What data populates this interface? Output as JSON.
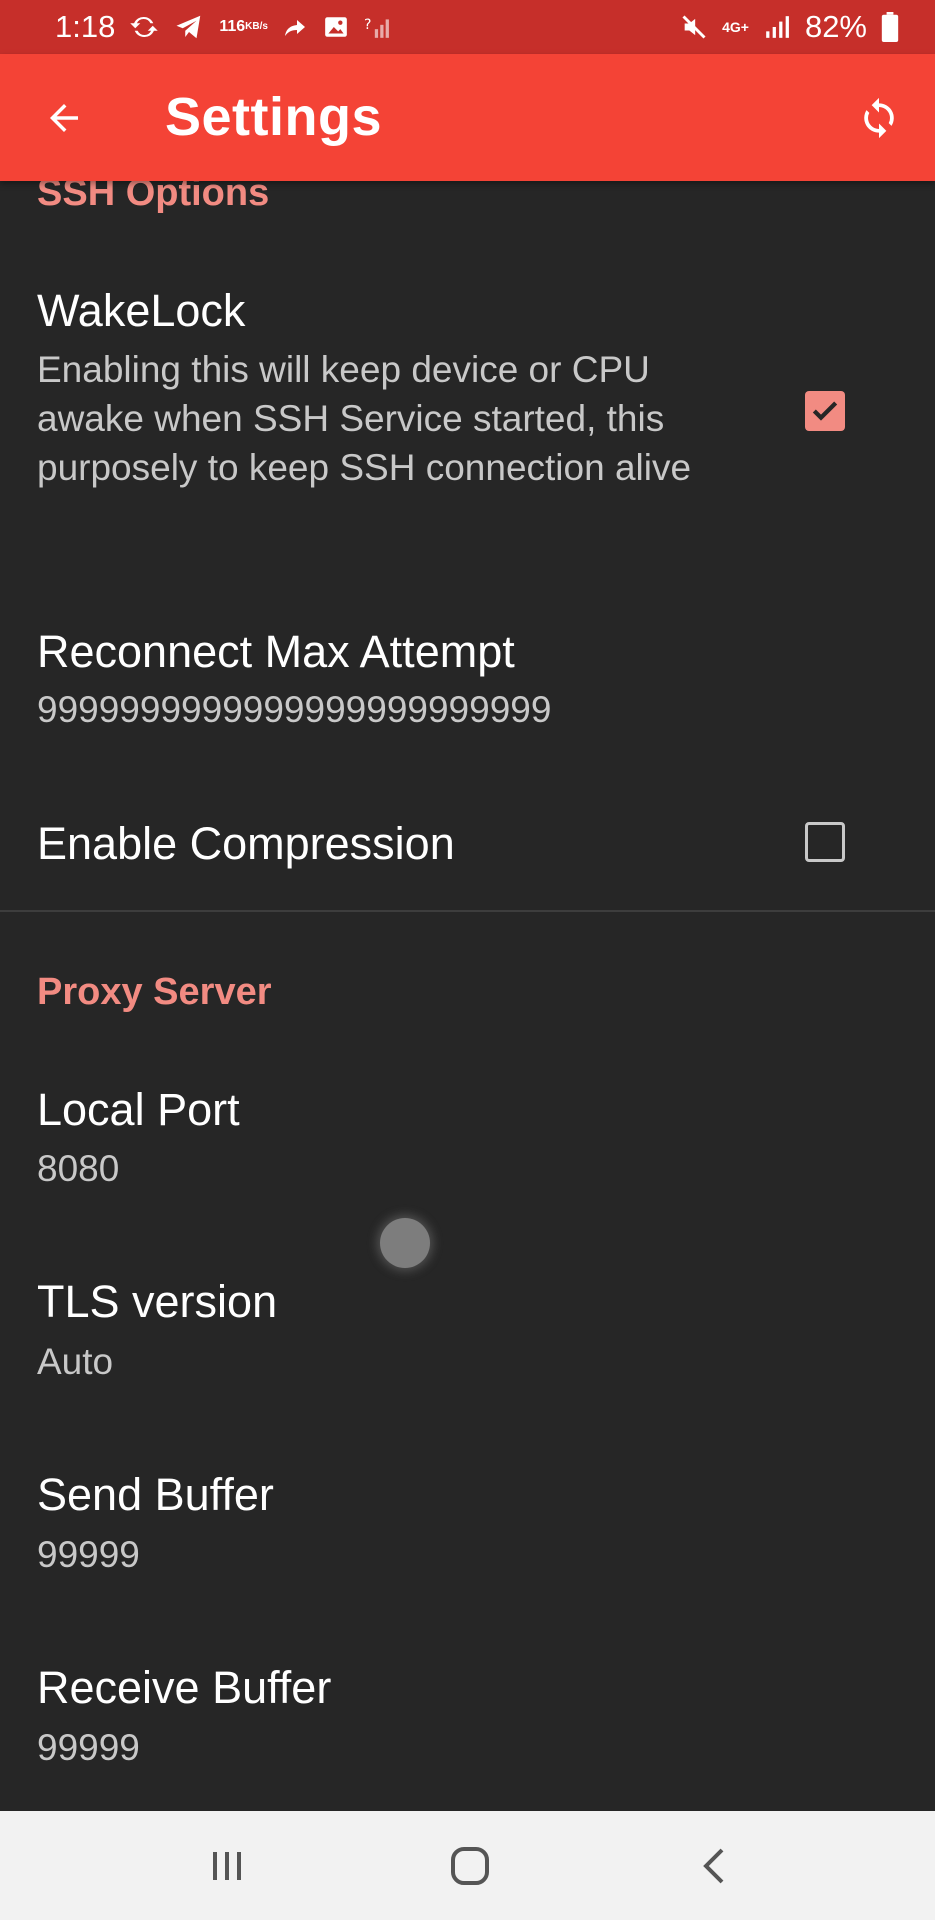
{
  "status_bar": {
    "time": "1:18",
    "speed_value": "116",
    "speed_unit": "KB/s",
    "network_type": "4G+",
    "battery": "82%",
    "icons": [
      "sync-icon",
      "telegram-icon",
      "forward-icon",
      "image-icon",
      "no-signal-icon",
      "mute-icon",
      "signal-icon",
      "battery-icon"
    ]
  },
  "app_bar": {
    "title": "Settings",
    "back_icon": "arrow-left-icon",
    "refresh_icon": "refresh-icon"
  },
  "sections": {
    "ssh": {
      "header": "SSH Options",
      "wakelock": {
        "title": "WakeLock",
        "summary": "Enabling this will keep device or CPU awake when SSH Service started, this purposely to keep SSH connection alive",
        "checked": true
      },
      "reconnect": {
        "title": "Reconnect Max Attempt",
        "value": "9999999999999999999999999"
      },
      "compression": {
        "title": "Enable Compression",
        "checked": false
      }
    },
    "proxy": {
      "header": "Proxy Server",
      "local_port": {
        "title": "Local Port",
        "value": "8080"
      },
      "tls": {
        "title": "TLS version",
        "value": "Auto"
      },
      "send_buffer": {
        "title": "Send Buffer",
        "value": "99999"
      },
      "receive_buffer": {
        "title": "Receive Buffer",
        "value": "99999"
      }
    }
  },
  "colors": {
    "status_bar": "#c62f2a",
    "app_bar": "#f44336",
    "accent": "#f28b82",
    "background": "#262626",
    "nav_bar": "#f2f2f2"
  },
  "nav_bar": {
    "icons": [
      "recent-apps-icon",
      "home-icon",
      "back-icon"
    ]
  }
}
